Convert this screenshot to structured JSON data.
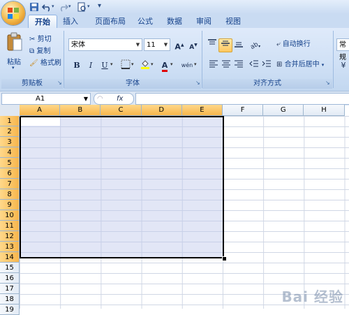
{
  "quick_access": {
    "save": "save-icon",
    "undo": "undo-icon",
    "redo": "redo-icon",
    "print_preview": "print-preview-icon",
    "customize": "▾"
  },
  "tabs": [
    {
      "label": "开始",
      "active": true
    },
    {
      "label": "插入",
      "active": false
    },
    {
      "label": "页面布局",
      "active": false
    },
    {
      "label": "公式",
      "active": false
    },
    {
      "label": "数据",
      "active": false
    },
    {
      "label": "审阅",
      "active": false
    },
    {
      "label": "视图",
      "active": false
    }
  ],
  "clipboard": {
    "paste": "粘贴",
    "cut": "剪切",
    "copy": "复制",
    "format_painter": "格式刷",
    "group": "剪贴板"
  },
  "font": {
    "name": "宋体",
    "size": "11",
    "grow": "A",
    "shrink": "A",
    "bold": "B",
    "italic": "I",
    "underline": "U",
    "phonetic": "wén",
    "group": "字体"
  },
  "alignment": {
    "wrap_text": "自动换行",
    "merge_center": "合并后居中",
    "group": "对齐方式"
  },
  "number": {
    "format": "常规"
  },
  "formula_bar": {
    "name_box": "A1",
    "fx": "fx",
    "formula": ""
  },
  "columns": [
    {
      "label": "A",
      "selected": true
    },
    {
      "label": "B",
      "selected": true
    },
    {
      "label": "C",
      "selected": true
    },
    {
      "label": "D",
      "selected": true
    },
    {
      "label": "E",
      "selected": true
    },
    {
      "label": "F",
      "selected": false
    },
    {
      "label": "G",
      "selected": false
    },
    {
      "label": "H",
      "selected": false
    }
  ],
  "rows": [
    "1",
    "2",
    "3",
    "4",
    "5",
    "6",
    "7",
    "8",
    "9",
    "10",
    "11",
    "12",
    "13",
    "14",
    "15",
    "16",
    "17",
    "18",
    "19"
  ],
  "selected_rows_count": 14,
  "selection_range": "A1:E14",
  "colors": {
    "accent": "#15428b",
    "selected_header": "#f7b64c",
    "selection_fill": "#c8cfea"
  },
  "watermark": "Bai 经验"
}
